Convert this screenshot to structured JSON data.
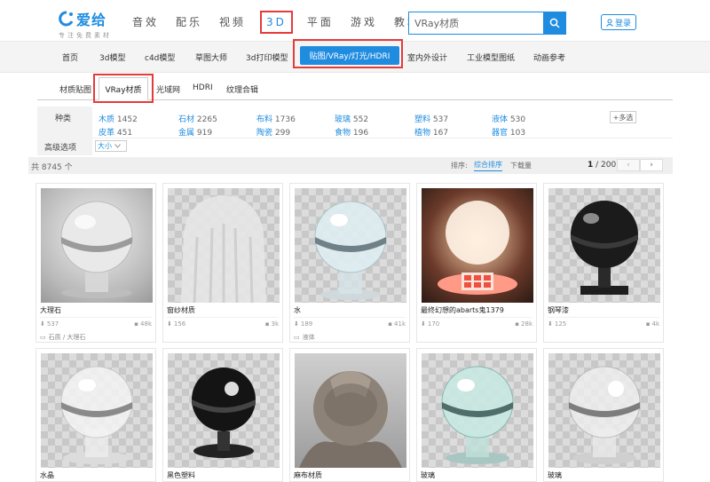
{
  "header": {
    "logo_text": "爱给",
    "logo_slogan": "专注免费素材",
    "nav": [
      "音效",
      "配乐",
      "视频",
      "3D",
      "平面",
      "游戏",
      "教程"
    ],
    "nav_active": "3D",
    "search_value": "VRay材质",
    "login_label": "登录"
  },
  "categories": {
    "items": [
      "首页",
      "3d模型",
      "c4d模型",
      "草图大师",
      "3d打印模型",
      "贴图/VRay/灯光/HDRI",
      "室内外设计",
      "工业模型图纸",
      "动画参考"
    ],
    "active": "贴图/VRay/灯光/HDRI"
  },
  "subtabs": {
    "items": [
      "材质贴图",
      "VRay材质",
      "光域网",
      "HDRI",
      "纹理合辑"
    ],
    "active": "VRay材质"
  },
  "filters": {
    "kind_label": "种类",
    "advanced_label": "高级选项",
    "size_label": "大小",
    "more_label": "多选",
    "row1": [
      {
        "name": "木质",
        "count": "1452"
      },
      {
        "name": "石材",
        "count": "2265"
      },
      {
        "name": "布料",
        "count": "1736"
      },
      {
        "name": "玻璃",
        "count": "552"
      },
      {
        "name": "塑料",
        "count": "537"
      },
      {
        "name": "液体",
        "count": "530"
      }
    ],
    "row2": [
      {
        "name": "皮革",
        "count": "451"
      },
      {
        "name": "金属",
        "count": "919"
      },
      {
        "name": "陶瓷",
        "count": "299"
      },
      {
        "name": "食物",
        "count": "196"
      },
      {
        "name": "植物",
        "count": "167"
      },
      {
        "name": "器官",
        "count": "103"
      }
    ]
  },
  "results": {
    "total": "共 8745 个",
    "sort_label": "排序:",
    "sort_active": "综合排序",
    "sort_other": "下载量",
    "page_current": "1",
    "page_total": "/ 200"
  },
  "cards": [
    {
      "title": "大理石",
      "views": "537",
      "downloads": "48k",
      "tag": "石质 / 大理石"
    },
    {
      "title": "窗纱材质",
      "views": "156",
      "downloads": "3k",
      "tag": ""
    },
    {
      "title": "水",
      "views": "189",
      "downloads": "41k",
      "tag": "液体"
    },
    {
      "title": "最终幻想的abarts鬼1379",
      "views": "170",
      "downloads": "28k",
      "tag": ""
    },
    {
      "title": "钢琴漆",
      "views": "125",
      "downloads": "4k",
      "tag": ""
    },
    {
      "title": "水晶",
      "views": "",
      "downloads": "",
      "tag": ""
    },
    {
      "title": "黑色塑料",
      "views": "",
      "downloads": "",
      "tag": ""
    },
    {
      "title": "麻布材质",
      "views": "",
      "downloads": "",
      "tag": ""
    },
    {
      "title": "玻璃",
      "views": "",
      "downloads": "",
      "tag": ""
    },
    {
      "title": "玻璃",
      "views": "",
      "downloads": "",
      "tag": ""
    }
  ],
  "colors": {
    "accent": "#1f8ce0",
    "highlight": "#e53b3b"
  }
}
